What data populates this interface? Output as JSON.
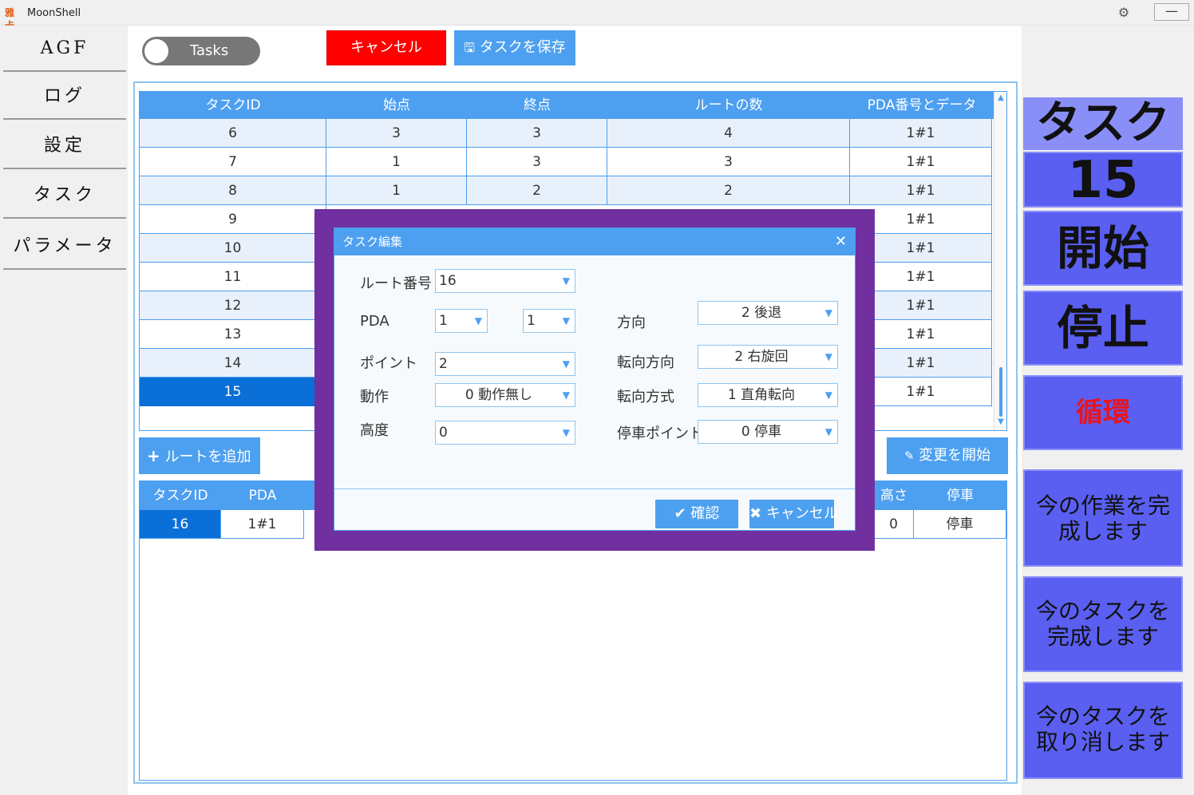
{
  "window": {
    "app_title": "MoonShell",
    "logo_text": "雅卡",
    "settings_icon": "gears-icon",
    "minimize_label": "—"
  },
  "sidebar": {
    "items": [
      {
        "label": "AGF"
      },
      {
        "label": "ログ"
      },
      {
        "label": "設定"
      },
      {
        "label": "タスク"
      },
      {
        "label": "パラメータ"
      }
    ]
  },
  "toolbar": {
    "toggle_label": "Tasks",
    "cancel_label": "キャンセル",
    "save_label": "タスクを保存"
  },
  "task_table": {
    "headers": [
      "タスクID",
      "始点",
      "終点",
      "ルートの数",
      "PDA番号とデータ"
    ],
    "rows": [
      [
        "6",
        "3",
        "3",
        "4",
        "1#1"
      ],
      [
        "7",
        "1",
        "3",
        "3",
        "1#1"
      ],
      [
        "8",
        "1",
        "2",
        "2",
        "1#1"
      ],
      [
        "9",
        "",
        "",
        "",
        "1#1"
      ],
      [
        "10",
        "",
        "",
        "",
        "1#1"
      ],
      [
        "11",
        "",
        "",
        "",
        "1#1"
      ],
      [
        "12",
        "",
        "",
        "",
        "1#1"
      ],
      [
        "13",
        "",
        "",
        "",
        "1#1"
      ],
      [
        "14",
        "",
        "",
        "",
        "1#1"
      ],
      [
        "15",
        "",
        "",
        "",
        "1#1"
      ]
    ],
    "selected_row": "15"
  },
  "route_actions": {
    "add_label": "ルートを追加",
    "change_label": "変更を開始"
  },
  "route_table": {
    "headers": [
      "タスクID",
      "PDA",
      "高さ",
      "停車"
    ],
    "row": [
      "16",
      "1#1",
      "0",
      "停車"
    ]
  },
  "right_panel": {
    "task_label": "タスク",
    "task_number": "15",
    "start_label": "開始",
    "stop_label": "停止",
    "loop_label": "循環",
    "finish_job_label": "今の作業を完成します",
    "finish_task_label": "今のタスクを完成します",
    "cancel_task_label": "今のタスクを取り消します",
    "loop_color": "#e8141e",
    "button_color": "#5a5ff2"
  },
  "dialog": {
    "title": "タスク編集",
    "route_no_label": "ルート番号",
    "route_no_value": "16",
    "pda_label": "PDA",
    "pda_value1": "1",
    "pda_value2": "1",
    "direction_label": "方向",
    "direction_value": "2 後退",
    "point_label": "ポイント",
    "point_value": "2",
    "turn_dir_label": "転向方向",
    "turn_dir_value": "2 右旋回",
    "action_label": "動作",
    "action_value": "0 動作無し",
    "turn_mode_label": "転向方式",
    "turn_mode_value": "1 直角転向",
    "height_label": "高度",
    "height_value": "0",
    "stop_point_label": "停車ポイント",
    "stop_point_value": "0 停車",
    "ok_label": "確認",
    "cancel_label": "キャンセル"
  },
  "colors": {
    "accent": "#4d9ff0",
    "selected": "#0a6fd6",
    "overlay": "#7030a0",
    "cancel_red": "#ff0000"
  }
}
